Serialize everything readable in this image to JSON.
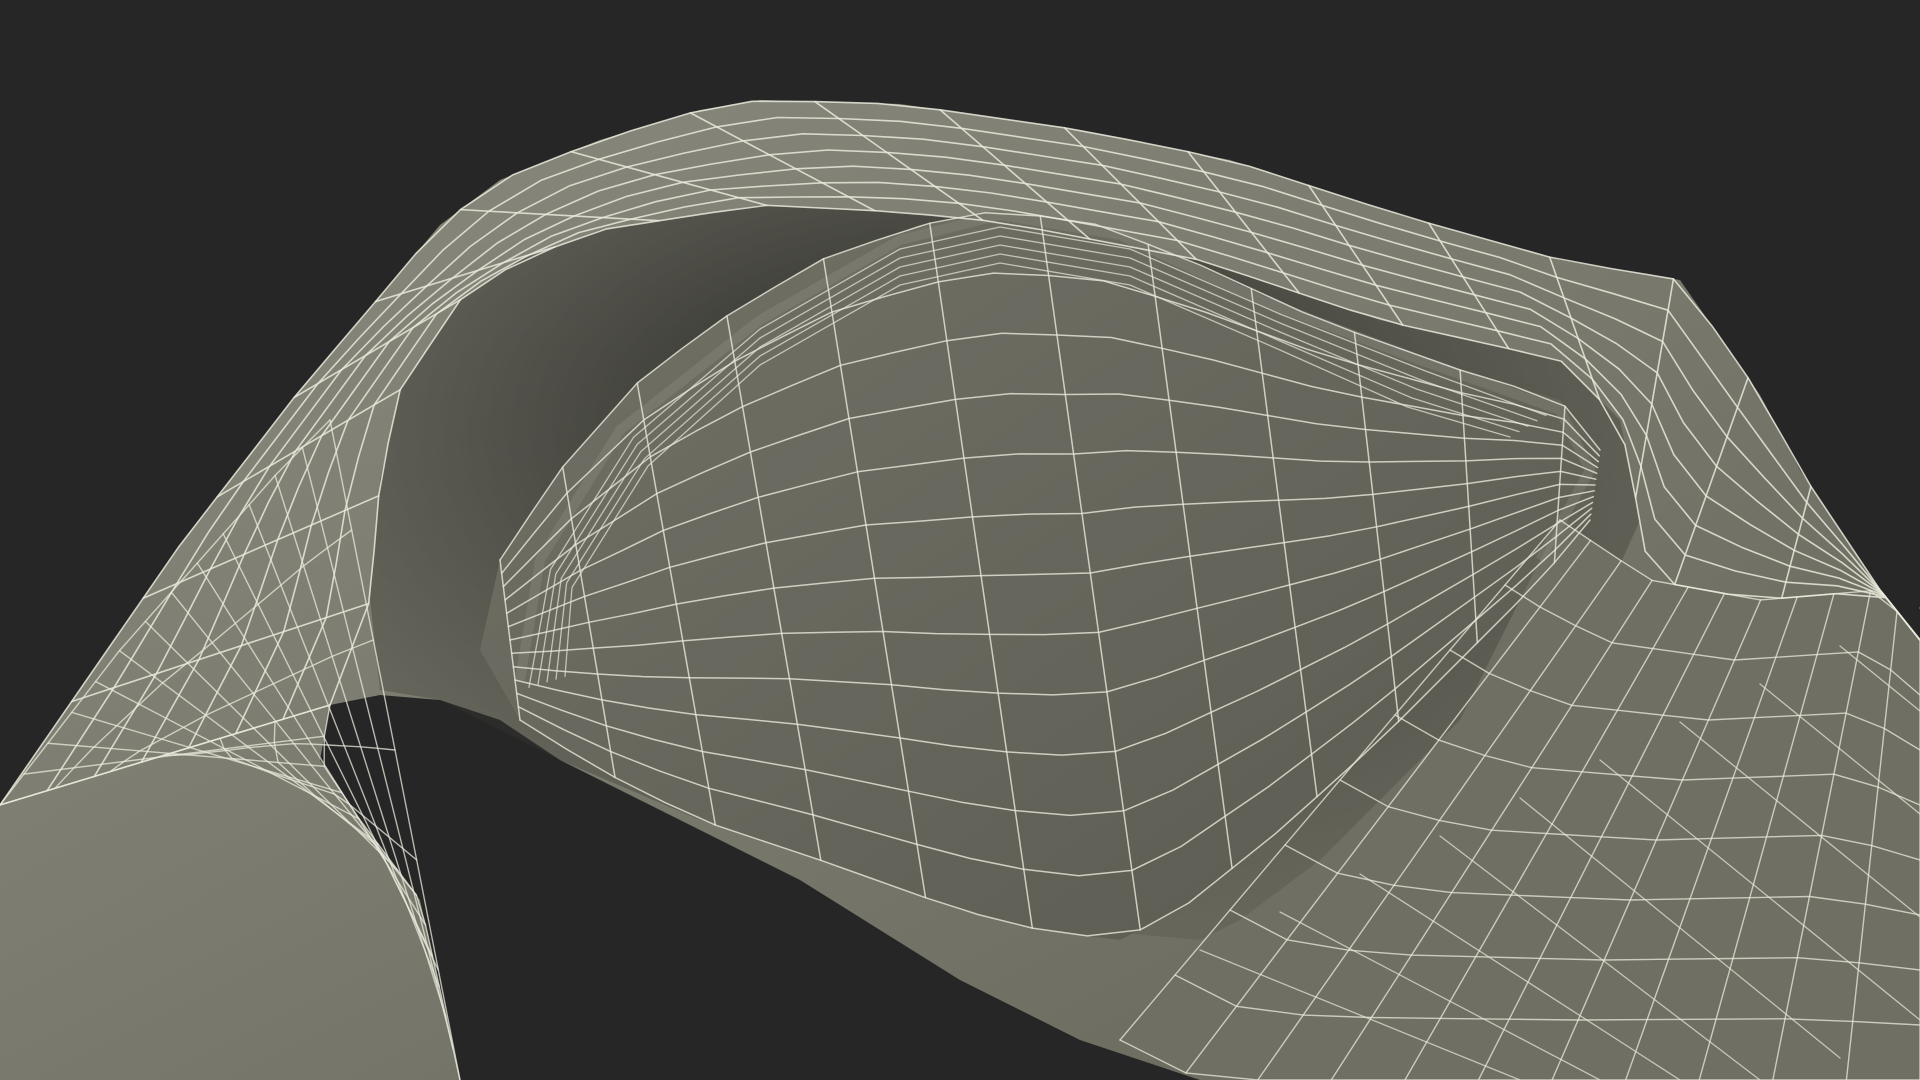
{
  "scene": {
    "background_color": "#262626",
    "surface_color": "#7b7b6f",
    "surface_shadow_color": "#4a4a44",
    "wire_color": "#e9e9dc"
  }
}
